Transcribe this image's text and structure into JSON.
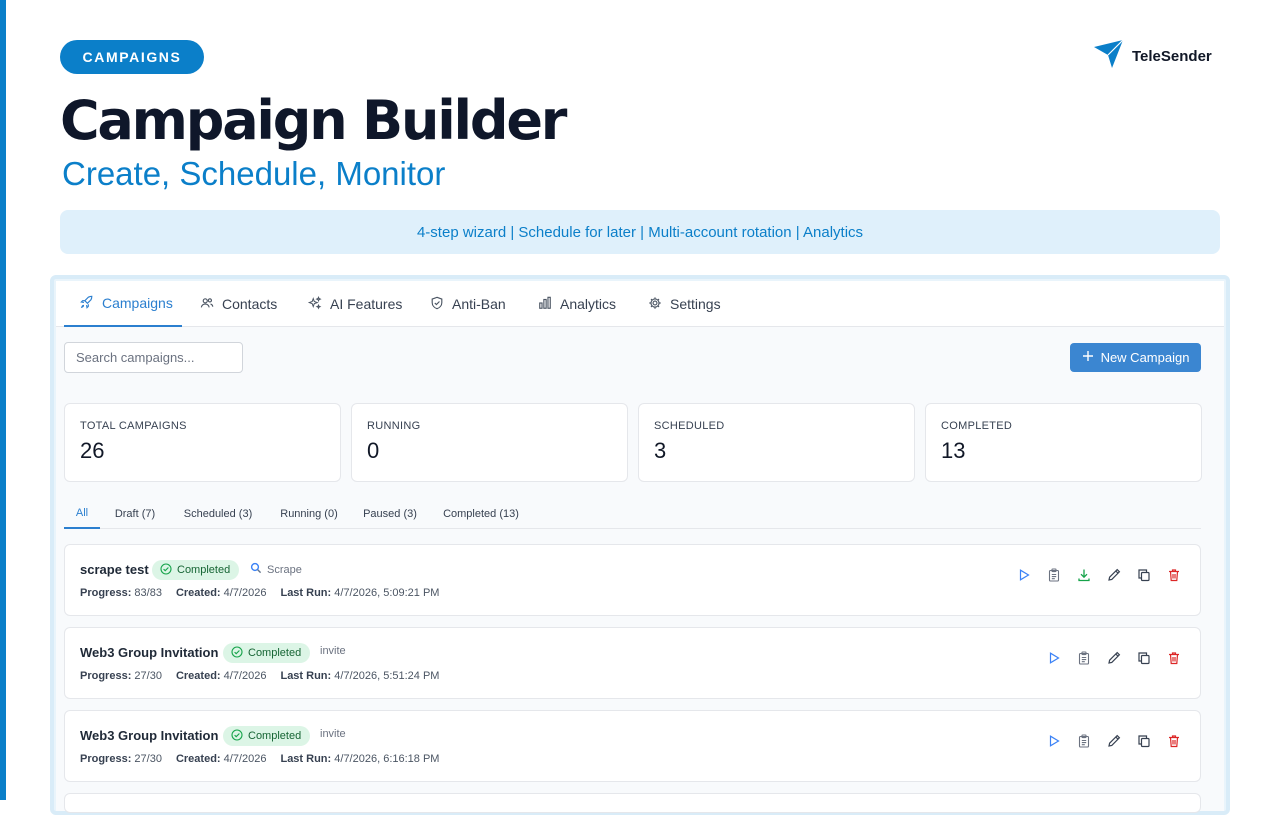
{
  "header": {
    "pill": "CAMPAIGNS",
    "title": "Campaign Builder",
    "subtitle": "Create, Schedule, Monitor",
    "banner": "4-step wizard | Schedule for later | Multi-account rotation | Analytics"
  },
  "brand": {
    "name": "TeleSender",
    "logo_icon": "paper-plane-icon",
    "color": "#0b7fc9"
  },
  "tabs": [
    {
      "label": "Campaigns",
      "icon": "rocket-icon",
      "active": true
    },
    {
      "label": "Contacts",
      "icon": "users-icon"
    },
    {
      "label": "AI Features",
      "icon": "sparkles-icon"
    },
    {
      "label": "Anti-Ban",
      "icon": "shield-icon"
    },
    {
      "label": "Analytics",
      "icon": "bar-chart-icon"
    },
    {
      "label": "Settings",
      "icon": "gear-icon"
    }
  ],
  "search": {
    "placeholder": "Search campaigns..."
  },
  "new_button": {
    "label": "New Campaign",
    "icon": "plus-icon"
  },
  "stats": [
    {
      "label": "TOTAL CAMPAIGNS",
      "value": "26"
    },
    {
      "label": "RUNNING",
      "value": "0"
    },
    {
      "label": "SCHEDULED",
      "value": "3"
    },
    {
      "label": "COMPLETED",
      "value": "13"
    }
  ],
  "filters": [
    "All",
    "Draft (7)",
    "Scheduled (3)",
    "Running (0)",
    "Paused (3)",
    "Completed (13)"
  ],
  "meta_labels": {
    "progress": "Progress:",
    "created": "Created:",
    "last_run": "Last Run:"
  },
  "campaigns": [
    {
      "name": "scrape test",
      "status": "Completed",
      "type": "Scrape",
      "progress": "83/83",
      "created": "4/7/2026",
      "last_run": "4/7/2026, 5:09:21 PM"
    },
    {
      "name": "Web3 Group Invitation",
      "status": "Completed",
      "type": "invite",
      "progress": "27/30",
      "created": "4/7/2026",
      "last_run": "4/7/2026, 5:51:24 PM"
    },
    {
      "name": "Web3 Group Invitation",
      "status": "Completed",
      "type": "invite",
      "progress": "27/30",
      "created": "4/7/2026",
      "last_run": "4/7/2026, 6:16:18 PM"
    }
  ],
  "colors": {
    "accent": "#0b7fc9",
    "primary_button": "#3b86d1",
    "success_bg": "#dcf5e6",
    "success_text": "#166534",
    "danger": "#dc2626",
    "download": "#16a34a"
  }
}
